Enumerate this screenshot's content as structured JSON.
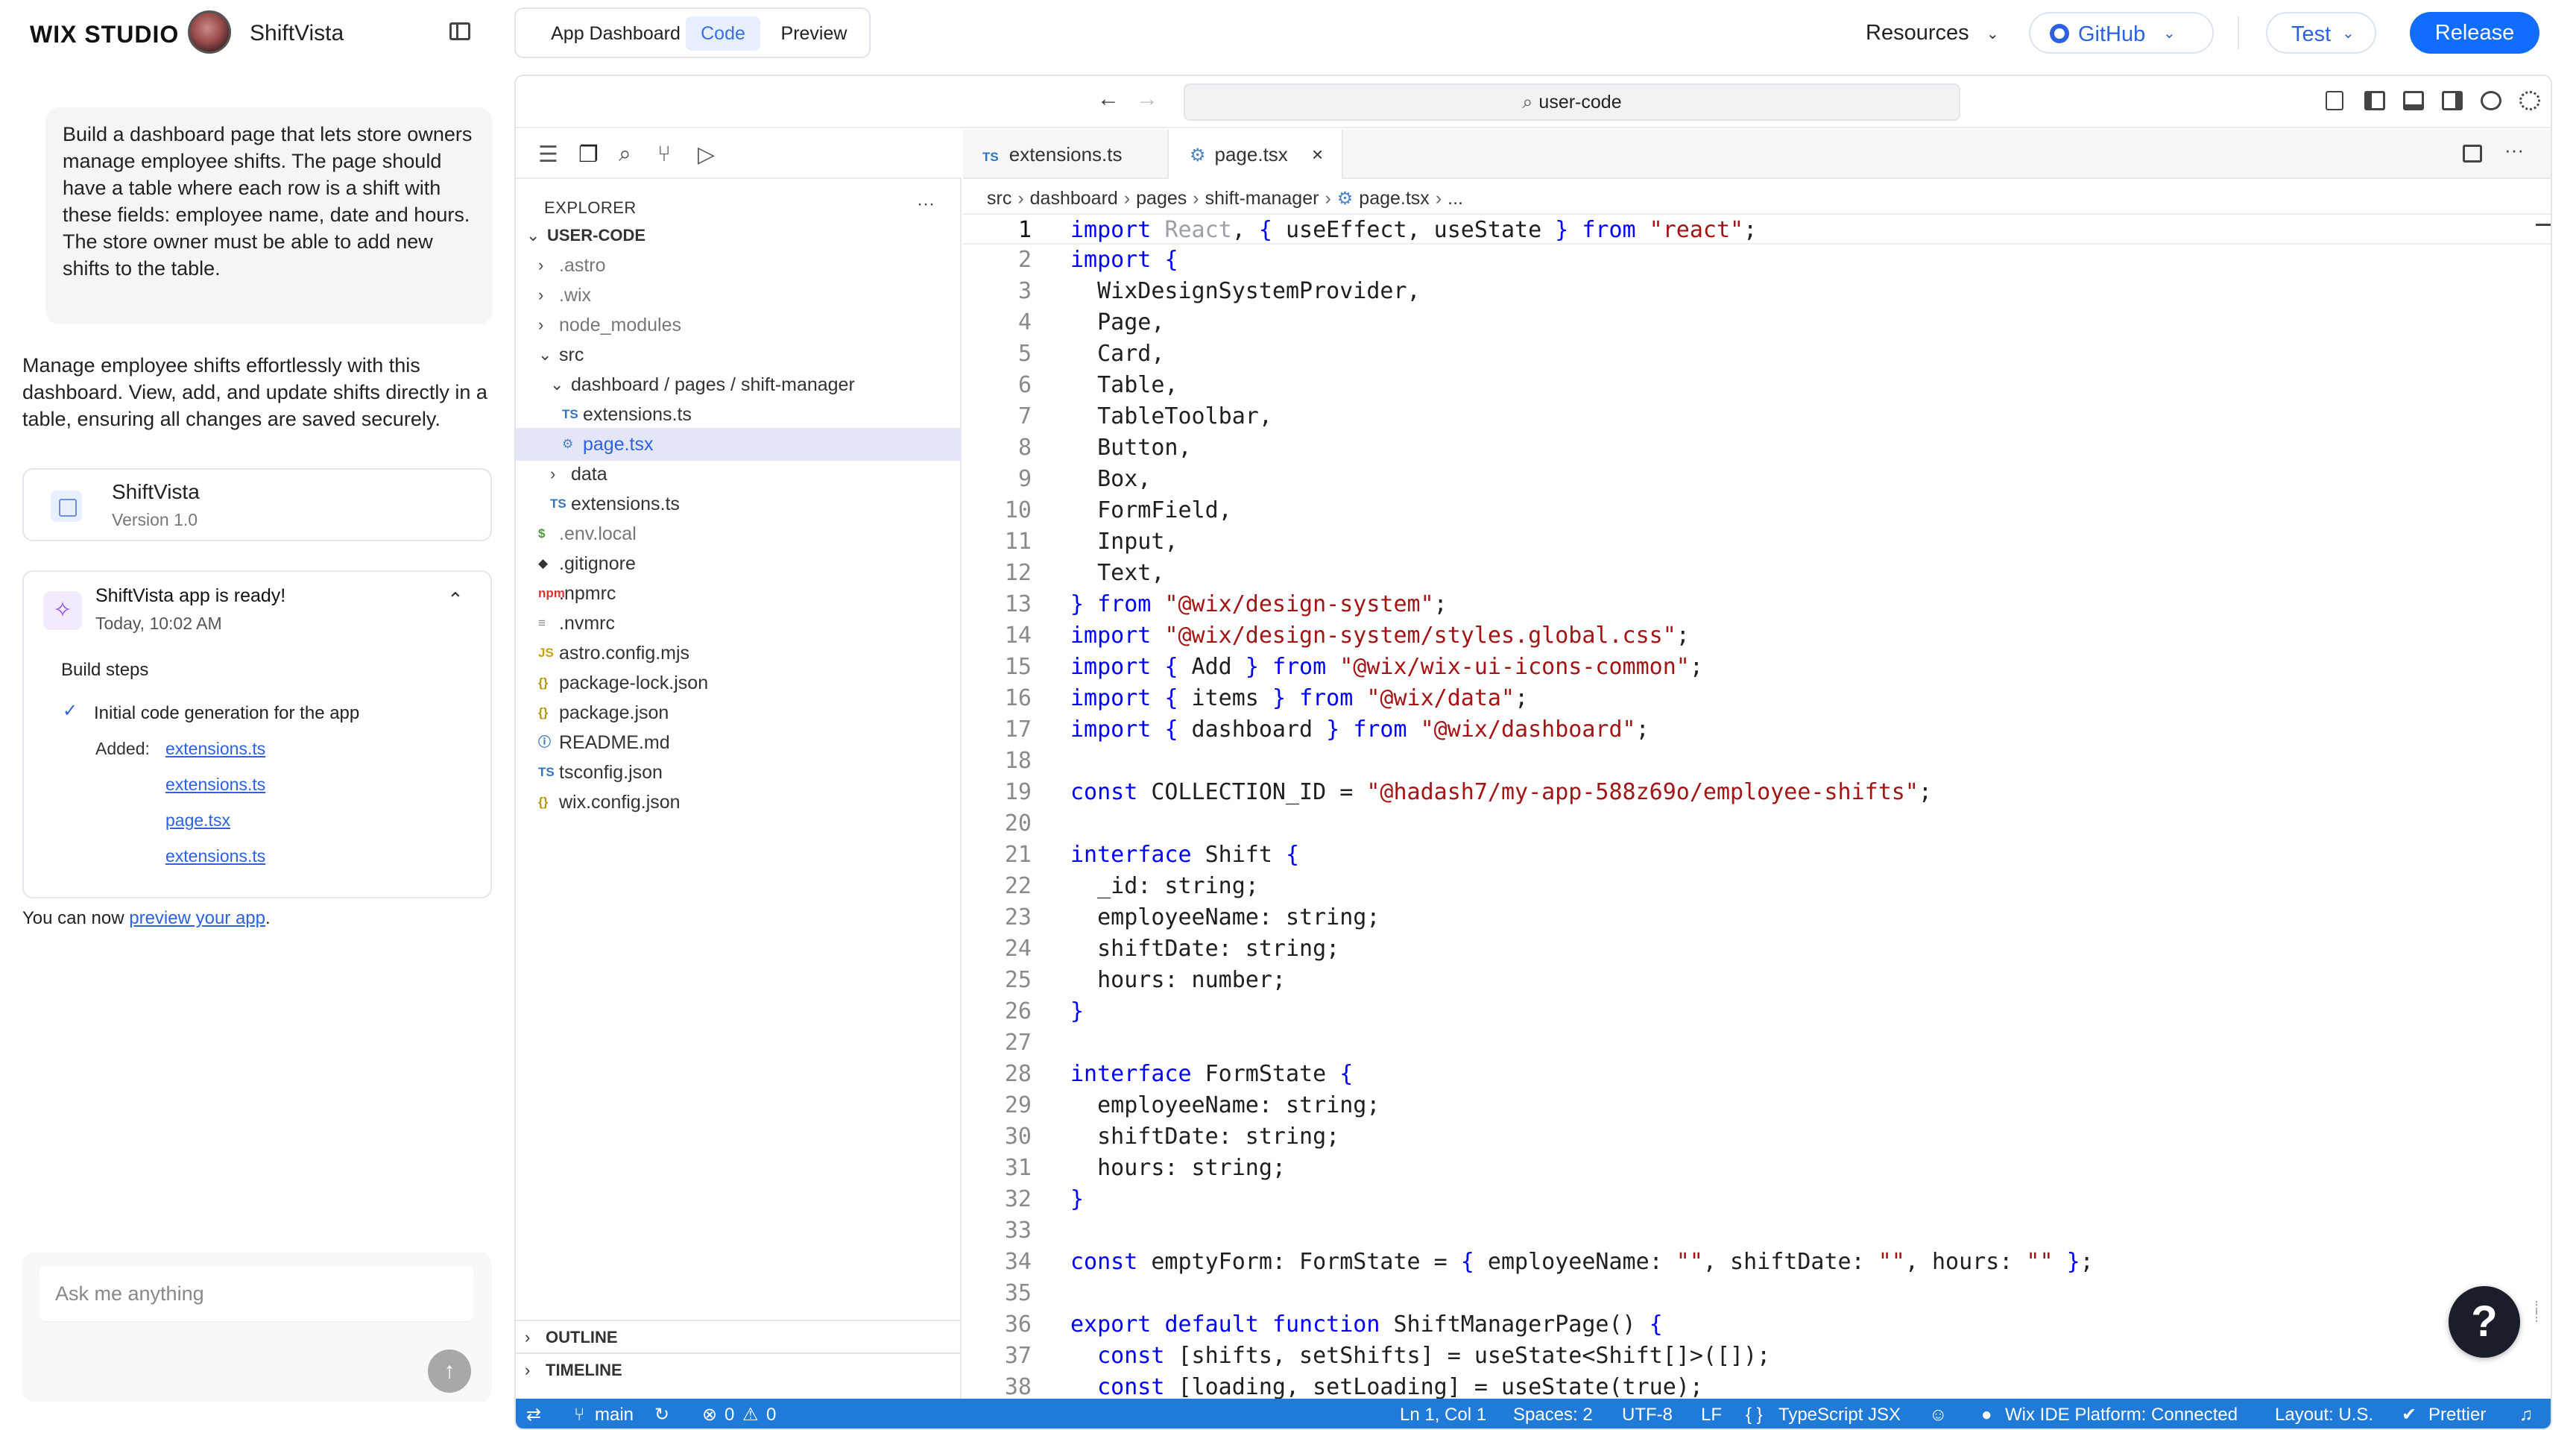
{
  "topbar": {
    "brand": "WIX STUDIO",
    "site_name": "ShiftVista",
    "tabs": [
      {
        "label": "App Dashboard",
        "active": false
      },
      {
        "label": "Code",
        "active": true
      },
      {
        "label": "Preview",
        "active": false
      }
    ],
    "resources_label": "Resources",
    "github_label": "GitHub",
    "test_label": "Test",
    "release_label": "Release",
    "accent": "#116dff"
  },
  "chat": {
    "prompt": "Build a dashboard page that lets store owners manage employee shifts. The page should have a table where each row is a shift with these fields: employee name, date and hours. The store owner must be able to add new shifts to the table.",
    "reply": "Manage employee shifts effortlessly with this dashboard. View, add, and update shifts directly in a table, ensuring all changes are saved securely.",
    "app_card": {
      "name": "ShiftVista",
      "version": "Version 1.0"
    },
    "ready_card": {
      "title": "ShiftVista app is ready!",
      "time": "Today, 10:02 AM",
      "build_steps_label": "Build steps",
      "step": "Initial code generation for the app",
      "added_label": "Added:",
      "added_files": [
        "extensions.ts",
        "extensions.ts",
        "page.tsx",
        "extensions.ts"
      ]
    },
    "preview_note_prefix": "You can now ",
    "preview_note_link": "preview your app",
    "preview_note_suffix": ".",
    "ask_placeholder": "Ask me anything"
  },
  "ide": {
    "search_text": "user-code",
    "explorer_label": "EXPLORER",
    "tree": [
      {
        "name": "USER-CODE",
        "kind": "root",
        "chev": "⌄",
        "depth": 0
      },
      {
        "name": ".astro",
        "kind": "folder",
        "chev": "›",
        "depth": 1
      },
      {
        "name": ".wix",
        "kind": "folder",
        "chev": "›",
        "depth": 1
      },
      {
        "name": "node_modules",
        "kind": "folder",
        "chev": "›",
        "depth": 1
      },
      {
        "name": "src",
        "kind": "folder",
        "chev": "⌄",
        "depth": 1
      },
      {
        "name": "dashboard / pages / shift-manager",
        "kind": "folder",
        "chev": "⌄",
        "depth": 2
      },
      {
        "name": "extensions.ts",
        "kind": "ts",
        "depth": 3
      },
      {
        "name": "page.tsx",
        "kind": "tsx",
        "depth": 3,
        "selected": true
      },
      {
        "name": "data",
        "kind": "folder",
        "chev": "›",
        "depth": 2
      },
      {
        "name": "extensions.ts",
        "kind": "ts",
        "depth": 2
      },
      {
        "name": ".env.local",
        "kind": "env",
        "depth": 1
      },
      {
        "name": ".gitignore",
        "kind": "git",
        "depth": 1
      },
      {
        "name": ".npmrc",
        "kind": "npm",
        "depth": 1
      },
      {
        "name": ".nvmrc",
        "kind": "txt",
        "depth": 1
      },
      {
        "name": "astro.config.mjs",
        "kind": "js",
        "depth": 1
      },
      {
        "name": "package-lock.json",
        "kind": "json",
        "depth": 1
      },
      {
        "name": "package.json",
        "kind": "json",
        "depth": 1
      },
      {
        "name": "README.md",
        "kind": "md",
        "depth": 1
      },
      {
        "name": "tsconfig.json",
        "kind": "tsconfig",
        "depth": 1
      },
      {
        "name": "wix.config.json",
        "kind": "json",
        "depth": 1
      }
    ],
    "outline_label": "OUTLINE",
    "timeline_label": "TIMELINE",
    "tabs": [
      {
        "label": "extensions.ts",
        "badge": "TS"
      },
      {
        "label": "page.tsx",
        "active": true
      }
    ],
    "breadcrumb": [
      "src",
      "dashboard",
      "pages",
      "shift-manager",
      "page.tsx",
      "..."
    ],
    "code_lines": [
      {
        "n": 1,
        "t": "import React, { useEffect, useState } from \"react\";"
      },
      {
        "n": 2,
        "t": "import {"
      },
      {
        "n": 3,
        "t": "  WixDesignSystemProvider,"
      },
      {
        "n": 4,
        "t": "  Page,"
      },
      {
        "n": 5,
        "t": "  Card,"
      },
      {
        "n": 6,
        "t": "  Table,"
      },
      {
        "n": 7,
        "t": "  TableToolbar,"
      },
      {
        "n": 8,
        "t": "  Button,"
      },
      {
        "n": 9,
        "t": "  Box,"
      },
      {
        "n": 10,
        "t": "  FormField,"
      },
      {
        "n": 11,
        "t": "  Input,"
      },
      {
        "n": 12,
        "t": "  Text,"
      },
      {
        "n": 13,
        "t": "} from \"@wix/design-system\";"
      },
      {
        "n": 14,
        "t": "import \"@wix/design-system/styles.global.css\";"
      },
      {
        "n": 15,
        "t": "import { Add } from \"@wix/wix-ui-icons-common\";"
      },
      {
        "n": 16,
        "t": "import { items } from \"@wix/data\";"
      },
      {
        "n": 17,
        "t": "import { dashboard } from \"@wix/dashboard\";"
      },
      {
        "n": 18,
        "t": ""
      },
      {
        "n": 19,
        "t": "const COLLECTION_ID = \"@hadash7/my-app-588z69o/employee-shifts\";"
      },
      {
        "n": 20,
        "t": ""
      },
      {
        "n": 21,
        "t": "interface Shift {"
      },
      {
        "n": 22,
        "t": "  _id: string;"
      },
      {
        "n": 23,
        "t": "  employeeName: string;"
      },
      {
        "n": 24,
        "t": "  shiftDate: string;"
      },
      {
        "n": 25,
        "t": "  hours: number;"
      },
      {
        "n": 26,
        "t": "}"
      },
      {
        "n": 27,
        "t": ""
      },
      {
        "n": 28,
        "t": "interface FormState {"
      },
      {
        "n": 29,
        "t": "  employeeName: string;"
      },
      {
        "n": 30,
        "t": "  shiftDate: string;"
      },
      {
        "n": 31,
        "t": "  hours: string;"
      },
      {
        "n": 32,
        "t": "}"
      },
      {
        "n": 33,
        "t": ""
      },
      {
        "n": 34,
        "t": "const emptyForm: FormState = { employeeName: \"\", shiftDate: \"\", hours: \"\" };"
      },
      {
        "n": 35,
        "t": ""
      },
      {
        "n": 36,
        "t": "export default function ShiftManagerPage() {"
      },
      {
        "n": 37,
        "t": "  const [shifts, setShifts] = useState<Shift[]>([]);"
      },
      {
        "n": 38,
        "t": "  const [loading, setLoading] = useState(true);"
      }
    ],
    "status": {
      "branch": "main",
      "errors": "0",
      "warnings": "0",
      "position": "Ln 1, Col 1",
      "spaces": "Spaces: 2",
      "encoding": "UTF-8",
      "eol": "LF",
      "language": "TypeScript JSX",
      "platform": "Wix IDE Platform: Connected",
      "layout": "Layout: U.S.",
      "formatter": "Prettier",
      "bar_color": "#1f7ad8"
    }
  },
  "help_label": "?"
}
